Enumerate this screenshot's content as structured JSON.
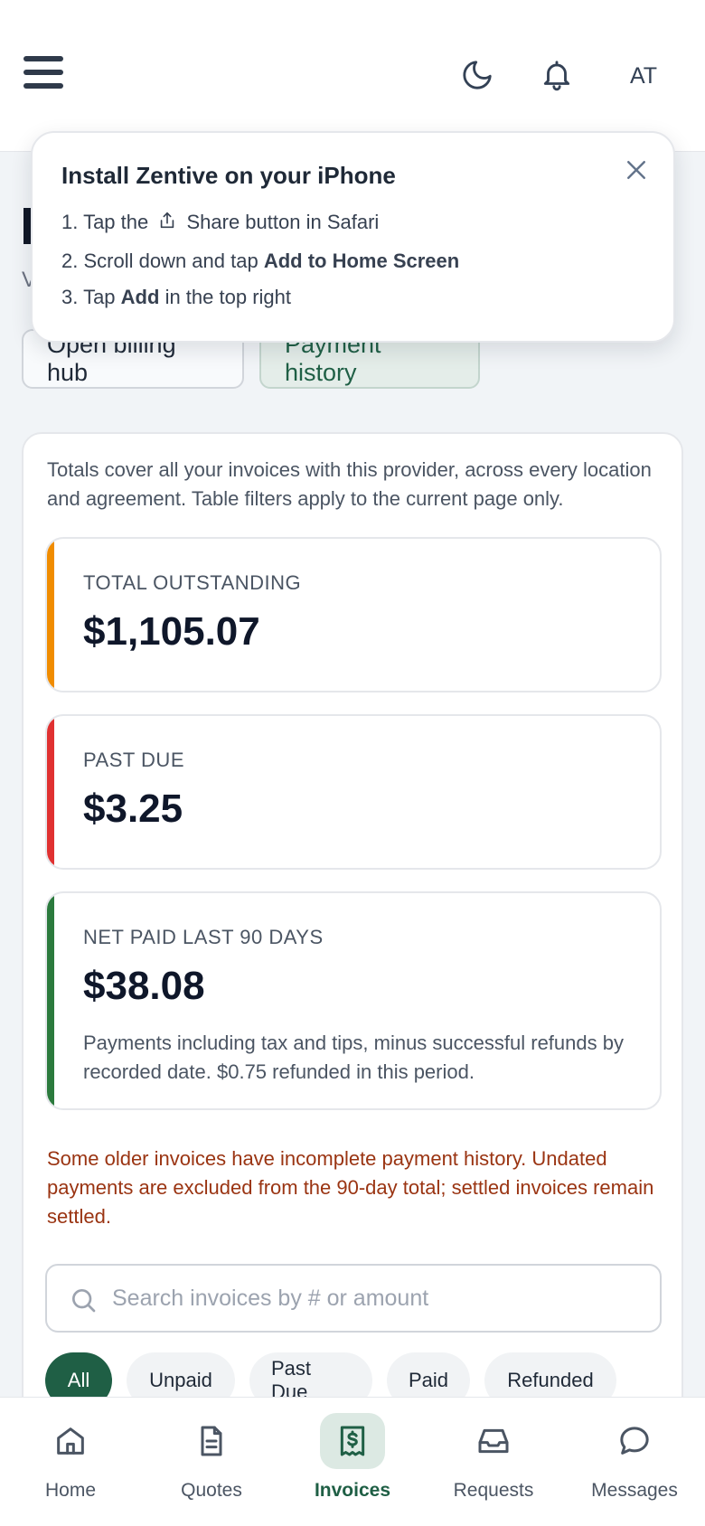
{
  "header": {
    "menu_icon": "hamburger-icon",
    "theme_icon": "moon-icon",
    "notifications_icon": "bell-icon",
    "avatar_initials": "AT"
  },
  "page": {
    "subtitle_stub": "V"
  },
  "actions": {
    "billing_hub": "Open billing hub",
    "payment_history": "Payment history"
  },
  "install_prompt": {
    "title": "Install Zentive on your iPhone",
    "step1_prefix": "1. Tap the",
    "step1_icon": "share-icon",
    "step1_suffix": "Share button in Safari",
    "step2_prefix": "2. Scroll down and tap",
    "step2_bold": "Add to Home Screen",
    "step3_prefix": "3. Tap",
    "step3_bold": "Add",
    "step3_suffix": "in the top right",
    "close_icon": "close-icon"
  },
  "summary": {
    "note": "Totals cover all your invoices with this provider, across every location and agreement. Table filters apply to the current page only.",
    "outstanding": {
      "label": "TOTAL OUTSTANDING",
      "value": "$1,105.07",
      "color": "#f08c00"
    },
    "past_due": {
      "label": "PAST DUE",
      "value": "$3.25",
      "color": "#e03131"
    },
    "net_paid": {
      "label": "NET PAID LAST 90 DAYS",
      "value": "$38.08",
      "description": "Payments including tax and tips, minus successful refunds by recorded date. $0.75 refunded in this period.",
      "color": "#2b7a3d"
    },
    "warning": "Some older invoices have incomplete payment history. Undated payments are excluded from the 90-day total; settled invoices remain settled."
  },
  "search": {
    "placeholder": "Search invoices by # or amount",
    "value": ""
  },
  "filters": [
    "All",
    "Unpaid",
    "Past Due",
    "Paid",
    "Refunded"
  ],
  "active_filter": "All",
  "nav": [
    {
      "label": "Home",
      "icon": "home-icon"
    },
    {
      "label": "Quotes",
      "icon": "document-icon"
    },
    {
      "label": "Invoices",
      "icon": "receipt-icon"
    },
    {
      "label": "Requests",
      "icon": "inbox-icon"
    },
    {
      "label": "Messages",
      "icon": "chat-icon"
    }
  ],
  "active_nav": "Invoices",
  "colors": {
    "brand": "#1f5f45",
    "warning_text": "#9a3412"
  }
}
